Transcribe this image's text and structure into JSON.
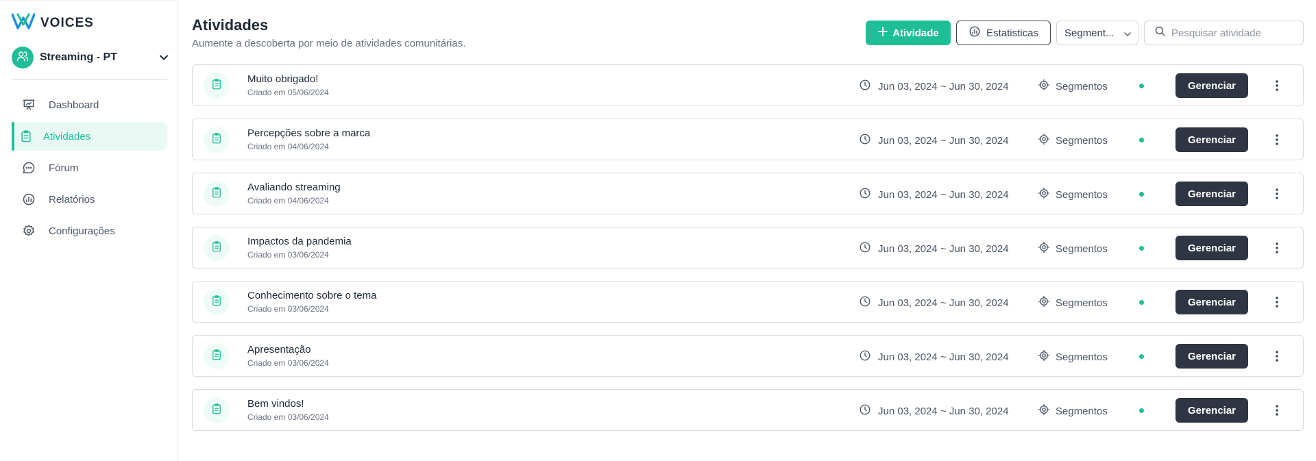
{
  "app": {
    "name": "VOICES"
  },
  "sidebar": {
    "community": {
      "name": "Streaming - PT"
    },
    "items": [
      {
        "label": "Dashboard",
        "icon": "presentation-icon",
        "active": false
      },
      {
        "label": "Atividades",
        "icon": "clipboard-icon",
        "active": true
      },
      {
        "label": "Fórum",
        "icon": "chat-bubble-icon",
        "active": false
      },
      {
        "label": "Relatórios",
        "icon": "report-chart-icon",
        "active": false
      },
      {
        "label": "Configurações",
        "icon": "gear-icon",
        "active": false
      }
    ]
  },
  "header": {
    "title": "Atividades",
    "subtitle": "Aumente a descoberta por meio de atividades comunitárias.",
    "new_activity_label": "Atividade",
    "stats_label": "Estatisticas",
    "segment_select_value": "Segment...",
    "search_placeholder": "Pesquisar atividade"
  },
  "activities": [
    {
      "title": "Muito obrigado!",
      "created": "Criado em 05/06/2024",
      "date_range": "Jun 03, 2024 ~ Jun 30, 2024",
      "segments": "Segmentos",
      "manage": "Gerenciar"
    },
    {
      "title": "Percepções sobre a marca",
      "created": "Criado em 04/06/2024",
      "date_range": "Jun 03, 2024 ~ Jun 30, 2024",
      "segments": "Segmentos",
      "manage": "Gerenciar"
    },
    {
      "title": "Avaliando streaming",
      "created": "Criado em 04/06/2024",
      "date_range": "Jun 03, 2024 ~ Jun 30, 2024",
      "segments": "Segmentos",
      "manage": "Gerenciar"
    },
    {
      "title": "Impactos da pandemia",
      "created": "Criado em 03/06/2024",
      "date_range": "Jun 03, 2024 ~ Jun 30, 2024",
      "segments": "Segmentos",
      "manage": "Gerenciar"
    },
    {
      "title": "Conhecimento sobre o tema",
      "created": "Criado em 03/06/2024",
      "date_range": "Jun 03, 2024 ~ Jun 30, 2024",
      "segments": "Segmentos",
      "manage": "Gerenciar"
    },
    {
      "title": "Apresentação",
      "created": "Criado em 03/06/2024",
      "date_range": "Jun 03, 2024 ~ Jun 30, 2024",
      "segments": "Segmentos",
      "manage": "Gerenciar"
    },
    {
      "title": "Bem vindos!",
      "created": "Criado em 03/06/2024",
      "date_range": "Jun 03, 2024 ~ Jun 30, 2024",
      "segments": "Segmentos",
      "manage": "Gerenciar"
    }
  ],
  "colors": {
    "accent": "#1ebf96",
    "dark_button": "#2f3542",
    "active_bg": "#e9faf5"
  }
}
